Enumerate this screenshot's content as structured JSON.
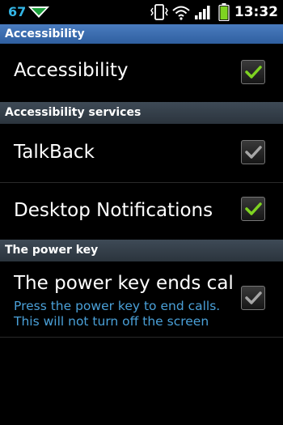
{
  "status_bar": {
    "notification_count": "67",
    "time": "13:32",
    "icons": [
      "notification-icon",
      "vibrate-icon",
      "wifi-icon",
      "signal-icon",
      "battery-icon"
    ]
  },
  "title_bar": {
    "title": "Accessibility"
  },
  "rows": {
    "accessibility": {
      "title": "Accessibility",
      "checked": true,
      "enabled": true
    },
    "talkback": {
      "title": "TalkBack",
      "checked": true,
      "enabled": false
    },
    "desktop_notifications": {
      "title": "Desktop Notifications",
      "checked": true,
      "enabled": true
    },
    "power_key": {
      "title": "The power key ends calls",
      "summary_line1": "Press the power key to end calls.",
      "summary_line2": "This will not turn off the screen",
      "checked": true,
      "enabled": false
    }
  },
  "sections": {
    "services": "Accessibility services",
    "power": "The power key"
  },
  "colors": {
    "accent_blue": "#33b5e5",
    "summary_blue": "#4aa0d8",
    "check_green": "#7ed321",
    "check_gray": "#a6a6a6",
    "battery_green": "#7ed321"
  }
}
